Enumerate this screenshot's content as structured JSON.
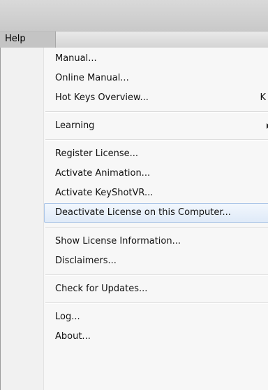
{
  "menubar": {
    "help_label": "Help"
  },
  "help_menu": {
    "items": [
      {
        "label": "Manual..."
      },
      {
        "label": "Online Manual..."
      },
      {
        "label": "Hot Keys Overview...",
        "shortcut": "K"
      },
      {
        "label": "Learning",
        "submenu": true
      },
      {
        "label": "Register License..."
      },
      {
        "label": "Activate Animation..."
      },
      {
        "label": "Activate KeyShotVR..."
      },
      {
        "label": "Deactivate License on this Computer...",
        "highlighted": true
      },
      {
        "label": "Show License Information..."
      },
      {
        "label": "Disclaimers..."
      },
      {
        "label": "Check for Updates..."
      },
      {
        "label": "Log..."
      },
      {
        "label": "About..."
      }
    ]
  }
}
